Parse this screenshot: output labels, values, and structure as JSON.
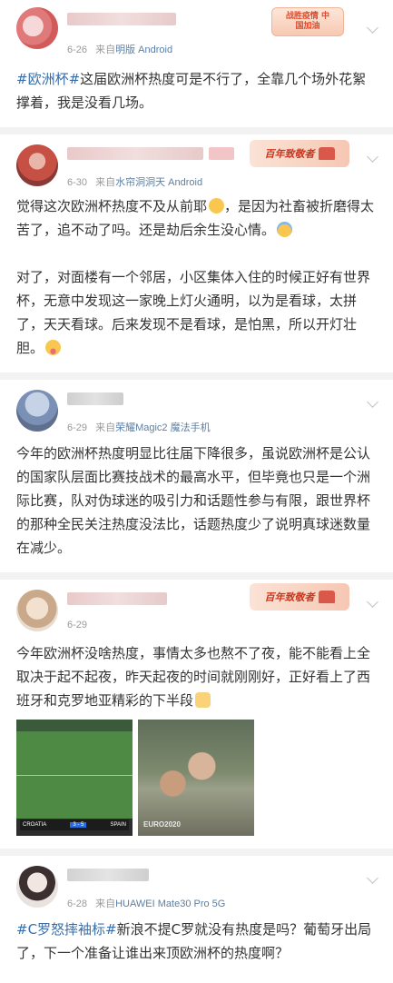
{
  "posts": [
    {
      "date": "6-26",
      "source_prefix": "来自",
      "source": "明版 Android",
      "badge": "战胜疫情 中国加油",
      "hashtag": "#欧洲杯#",
      "text": "这届欧洲杯热度可是不行了，全靠几个场外花絮撑着，我是没看几场。"
    },
    {
      "date": "6-30",
      "source_prefix": "来自",
      "source": "水帘洞洞天 Android",
      "badge": "百年致敬者",
      "text_p1": "觉得这次欧洲杯热度不及从前耶",
      "text_p2": "，是因为社畜被折磨得太苦了，追不动了吗。还是劫后余生没心情。",
      "text_p3": "对了，对面楼有一个邻居，小区集体入住的时候正好有世界杯，无意中发现这一家晚上灯火通明，以为是看球，太拼了，天天看球。后来发现不是看球，是怕黑，所以开灯壮胆。"
    },
    {
      "date": "6-29",
      "source_prefix": "来自",
      "source": "荣耀Magic2 魔法手机",
      "text": "今年的欧洲杯热度明显比往届下降很多，虽说欧洲杯是公认的国家队层面比赛技战术的最高水平，但毕竟也只是一个洲际比赛，队对伪球迷的吸引力和话题性参与有限，跟世界杯的那种全民关注热度没法比，话题热度少了说明真球迷数量在减少。"
    },
    {
      "date": "6-29",
      "badge": "百年致敬者",
      "text": "今年欧洲杯没啥热度，事情太多也熬不了夜，能不能看上全取决于起不起夜，昨天起夜的时间就刚刚好，正好看上了西班牙和克罗地亚精彩的下半段",
      "score_left": "CROATIA",
      "score": "3 - 5",
      "score_right": "SPAIN",
      "banner": "EURO2020"
    },
    {
      "date": "6-28",
      "source_prefix": "来自",
      "source": "HUAWEI Mate30 Pro 5G",
      "hashtag": "#C罗怒摔袖标#",
      "text": "新浪不提C罗就没有热度是吗？葡萄牙出局了，下一个准备让谁出来顶欧洲杯的热度啊？"
    }
  ]
}
